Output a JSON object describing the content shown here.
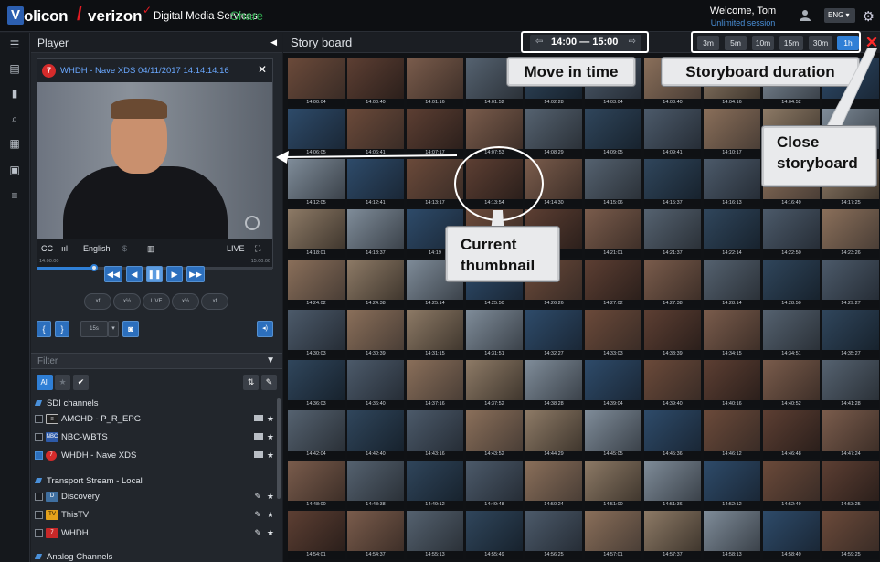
{
  "brand": {
    "logo_letter": "V",
    "logo_text": "olicon",
    "slash": "/",
    "partner": "verizon",
    "check": "✓",
    "product": "Digital Media Services",
    "share": "Share"
  },
  "user": {
    "welcome": "Welcome, Tom",
    "session": "Unlimited session",
    "lang": "ENG ▾"
  },
  "player": {
    "title": "Player",
    "video_title": "WHDH - Nave XDS  04/11/2017 14:14:14.16",
    "channel_logo_text": "7",
    "cc": "CC",
    "bars": "ııl",
    "language": "English",
    "live": "LIVE",
    "time_start": "14:00:00",
    "time_end": "15:00:00",
    "progress": 0.24
  },
  "controls": {
    "rewind": "◀◀",
    "step_back": "◀",
    "pause": "❚❚",
    "play": "▶",
    "forward": "▶▶",
    "speed_back_fast": "xf",
    "speed_back": "x½",
    "live": "LIVE",
    "speed_fwd": "x½",
    "speed_fwd_fast": "xf",
    "mark_in": "{",
    "mark_out": "}",
    "clip_len": "15s",
    "clip_len_arrow": "▾",
    "snapshot": "◙",
    "audio": "◂)"
  },
  "filter": {
    "placeholder": "Filter",
    "all": "All"
  },
  "channel_groups": [
    {
      "name": "SDI channels",
      "channels": [
        {
          "name": "AMCHD - P_R_EPG",
          "logo": "≡",
          "checked": false
        },
        {
          "name": "NBC-WBTS",
          "logo": "NBC",
          "checked": false
        },
        {
          "name": "WHDH - Nave XDS",
          "logo": "7",
          "checked": true
        }
      ]
    },
    {
      "name": "Transport Stream - Local",
      "channels": [
        {
          "name": "Discovery",
          "logo": "D",
          "checked": false
        },
        {
          "name": "ThisTV",
          "logo": "TV",
          "checked": false
        },
        {
          "name": "WHDH",
          "logo": "7",
          "checked": false
        }
      ]
    },
    {
      "name": "Analog Channels",
      "channels": []
    }
  ],
  "storyboard": {
    "title": "Story board",
    "time_range": "14:00  —  15:00",
    "durations": [
      "3m",
      "5m",
      "10m",
      "15m",
      "30m",
      "1h"
    ],
    "selected_duration": "1h",
    "close": "✕",
    "rows": [
      [
        "14:00:04",
        "14:00:40",
        "14:01:16",
        "14:01:52",
        "14:02:28",
        "14:03:04",
        "14:03:40",
        "14:04:16",
        "14:04:52",
        ""
      ],
      [
        "14:06:05",
        "14:06:41",
        "14:07:17",
        "14:07:53",
        "14:08:29",
        "14:09:05",
        "14:09:41",
        "14:10:17",
        "",
        ""
      ],
      [
        "14:12:05",
        "14:12:41",
        "14:13:17",
        "14:13:54",
        "14:14:30",
        "14:15:06",
        "14:15:37",
        "14:16:13",
        "14:16:49",
        "14:17:25"
      ],
      [
        "14:18:01",
        "14:18:37",
        "14:19",
        "",
        "14:25",
        "14:21:01",
        "14:21:37",
        "14:22:14",
        "14:22:50",
        "14:23:26"
      ],
      [
        "14:24:02",
        "14:24:38",
        "14:25:14",
        "14:25:50",
        "14:26:26",
        "14:27:02",
        "14:27:38",
        "14:28:14",
        "14:28:50",
        "14:29:27"
      ],
      [
        "14:30:03",
        "14:30:39",
        "14:31:15",
        "14:31:51",
        "14:32:27",
        "14:33:03",
        "14:33:39",
        "14:34:15",
        "14:34:51",
        "14:35:27"
      ],
      [
        "14:36:03",
        "14:36:40",
        "14:37:16",
        "14:37:52",
        "14:38:28",
        "14:39:04",
        "14:39:40",
        "14:40:16",
        "14:40:52",
        "14:41:28"
      ],
      [
        "14:42:04",
        "14:42:40",
        "14:43:16",
        "14:43:52",
        "14:44:29",
        "14:45:05",
        "14:45:36",
        "14:46:12",
        "14:46:48",
        "14:47:24"
      ],
      [
        "14:48:00",
        "14:48:38",
        "14:49:12",
        "14:49:48",
        "14:50:24",
        "14:51:00",
        "14:51:36",
        "14:52:12",
        "14:52:49",
        "14:53:25"
      ],
      [
        "14:54:01",
        "14:54:37",
        "14:55:13",
        "14:55:49",
        "14:56:25",
        "14:57:01",
        "14:57:37",
        "14:58:13",
        "14:58:49",
        "14:59:25"
      ]
    ],
    "current": "14:13:54"
  },
  "callouts": {
    "move_in_time": "Move in time",
    "duration": "Storyboard duration",
    "close_line1": "Close",
    "close_line2": "storyboard",
    "current_line1": "Current",
    "current_line2": "thumbnail"
  },
  "icons": {
    "rail": [
      "menu-icon",
      "layout-icon",
      "bookmark-icon",
      "search-icon",
      "calendar-icon",
      "monitor-icon",
      "list-icon"
    ]
  }
}
